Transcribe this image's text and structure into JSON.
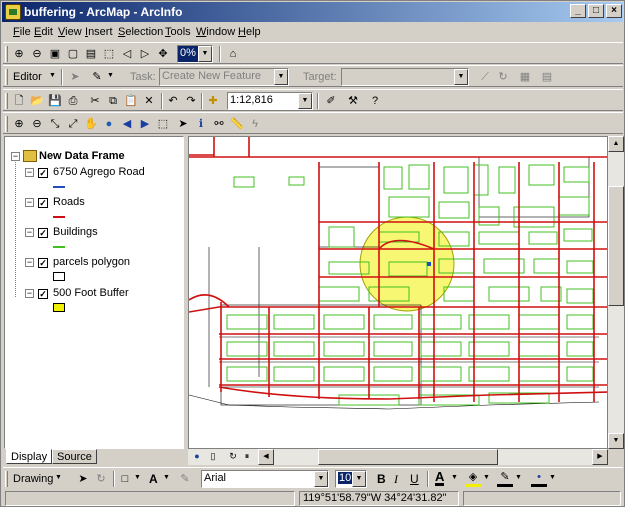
{
  "window": {
    "title": "buffering - ArcMap - ArcInfo",
    "controls": {
      "minimize": "_",
      "maximize": "□",
      "close": "×"
    }
  },
  "menu": {
    "file": "File",
    "edit": "Edit",
    "view": "View",
    "insert": "Insert",
    "selection": "Selection",
    "tools": "Tools",
    "window": "Window",
    "help": "Help"
  },
  "layout_toolbar": {
    "zoom_percent": "0%"
  },
  "editor_toolbar": {
    "editor_label": "Editor",
    "task_label": "Task:",
    "task_value": "Create New Feature",
    "target_label": "Target:",
    "target_value": ""
  },
  "standard_toolbar": {
    "scale": "1:12,816"
  },
  "toc": {
    "data_frame": "New Data Frame",
    "layers": [
      {
        "name": "6750 Agrego Road",
        "checked": true,
        "symbol": "line",
        "color": "#1f4fbf"
      },
      {
        "name": "Roads",
        "checked": true,
        "symbol": "line",
        "color": "#d01010"
      },
      {
        "name": "Buildings",
        "checked": true,
        "symbol": "line",
        "color": "#40c020"
      },
      {
        "name": "parcels polygon",
        "checked": true,
        "symbol": "box",
        "color": "#ffffff"
      },
      {
        "name": "500 Foot Buffer",
        "checked": true,
        "symbol": "box",
        "color": "#f0f000"
      }
    ],
    "tabs": {
      "display": "Display",
      "source": "Source"
    }
  },
  "drawing_toolbar": {
    "drawing_label": "Drawing",
    "font_name": "Arial",
    "font_size": "10",
    "bold": "B",
    "italic": "I",
    "underline": "U",
    "text_a": "A"
  },
  "status": {
    "coordinates": "119°51'58.79\"W  34°24'31.82\""
  },
  "colors": {
    "roads": "#d01010",
    "buildings": "#40c020",
    "buffer": "#f0f000",
    "selection": "#1f4fbf"
  }
}
